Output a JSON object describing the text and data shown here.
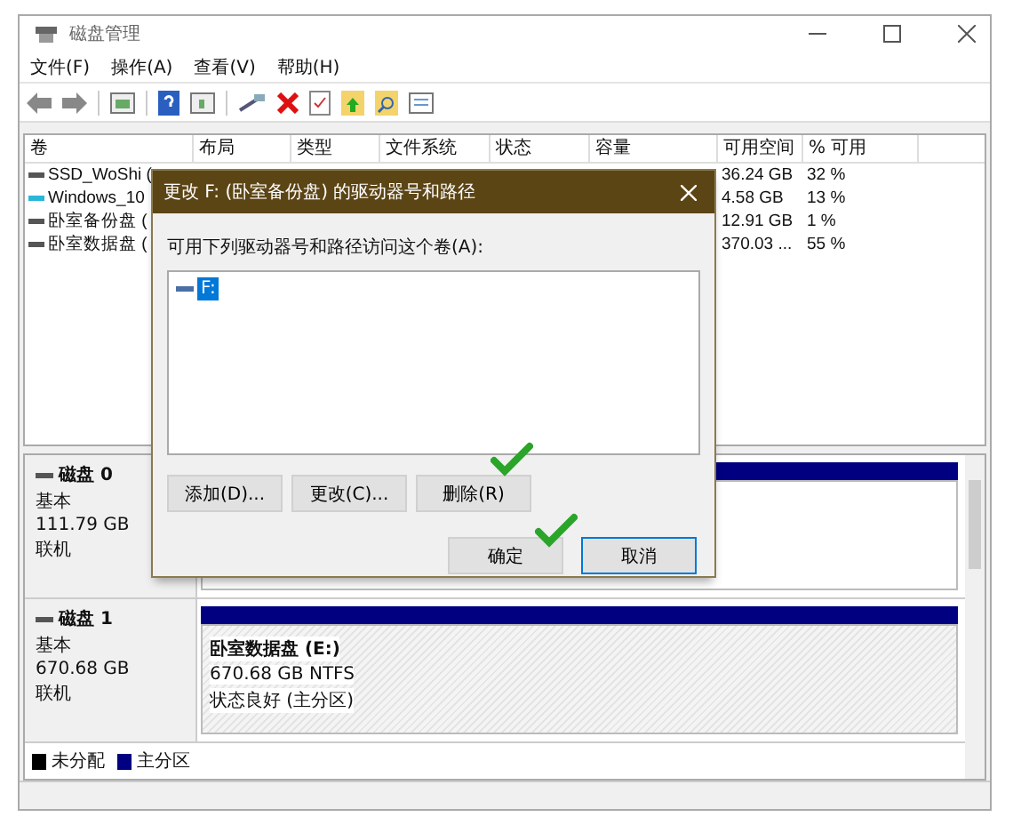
{
  "window": {
    "title": "磁盘管理"
  },
  "menu": [
    "文件(F)",
    "操作(A)",
    "查看(V)",
    "帮助(H)"
  ],
  "table": {
    "columns": [
      "卷",
      "布局",
      "类型",
      "文件系统",
      "状态",
      "容量",
      "可用空间",
      "% 可用"
    ],
    "rows": [
      {
        "volume": "SSD_WoShi (",
        "free": "36.24 GB",
        "percent_free": "32 %",
        "color": "#555555"
      },
      {
        "volume": "Windows_10",
        "free": "4.58 GB",
        "percent_free": "13 %",
        "color": "#29b6d8"
      },
      {
        "volume": "卧室备份盘 (",
        "free": "12.91 GB",
        "percent_free": "1 %",
        "color": "#555555"
      },
      {
        "volume": "卧室数据盘 (",
        "free": "370.03 ...",
        "percent_free": "55 %",
        "color": "#555555"
      }
    ]
  },
  "disks": [
    {
      "name": "磁盘 0",
      "type": "基本",
      "size": "111.79 GB",
      "status": "联机"
    },
    {
      "name": "磁盘 1",
      "type": "基本",
      "size": "670.68 GB",
      "status": "联机",
      "partitions": [
        {
          "title": "卧室数据盘  (E:)",
          "detail": "670.68 GB NTFS",
          "status": "状态良好 (主分区)"
        }
      ]
    }
  ],
  "legend": [
    {
      "label": "未分配",
      "color": "#000000"
    },
    {
      "label": "主分区",
      "color": "#000080"
    }
  ],
  "dialog": {
    "title": "更改 F: (卧室备份盘) 的驱动器号和路径",
    "prompt": "可用下列驱动器号和路径访问这个卷(A):",
    "items": [
      {
        "label": "F:",
        "selected": true
      }
    ],
    "buttons": [
      "添加(D)...",
      "更改(C)...",
      "删除(R)"
    ],
    "ok": "确定",
    "cancel": "取消"
  }
}
